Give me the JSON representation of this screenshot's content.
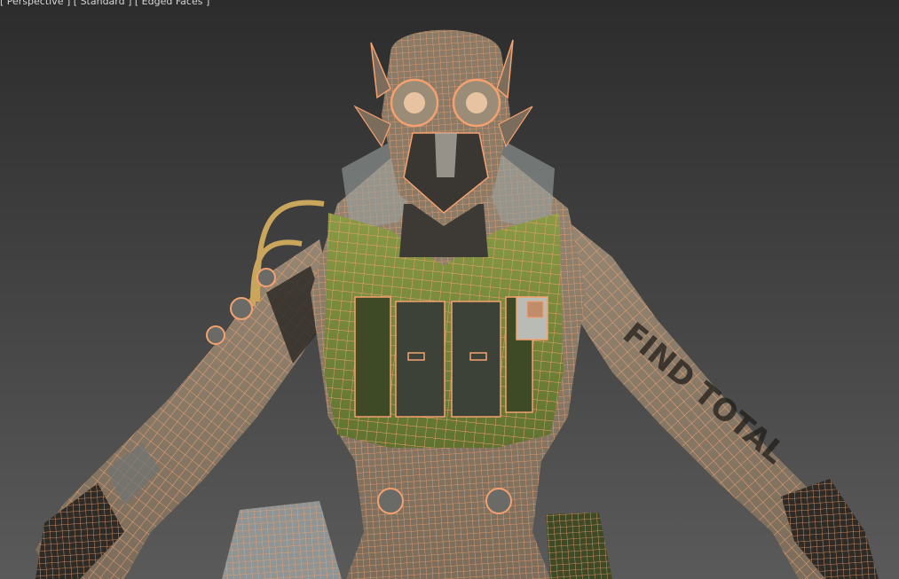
{
  "viewport": {
    "label": "[ Perspective ] [ Standard ] [ Edged Faces ]",
    "background_top": "#2c2c2c",
    "background_bottom": "#5a5a5a"
  },
  "model": {
    "wire_color": "#f4a170",
    "vest_color": "#7a8c3c",
    "skin_color": "#8d7e6a",
    "metal_color": "#8f9594",
    "dark_color": "#2c2a26",
    "tattoo_text": "FIND TOTAL"
  }
}
